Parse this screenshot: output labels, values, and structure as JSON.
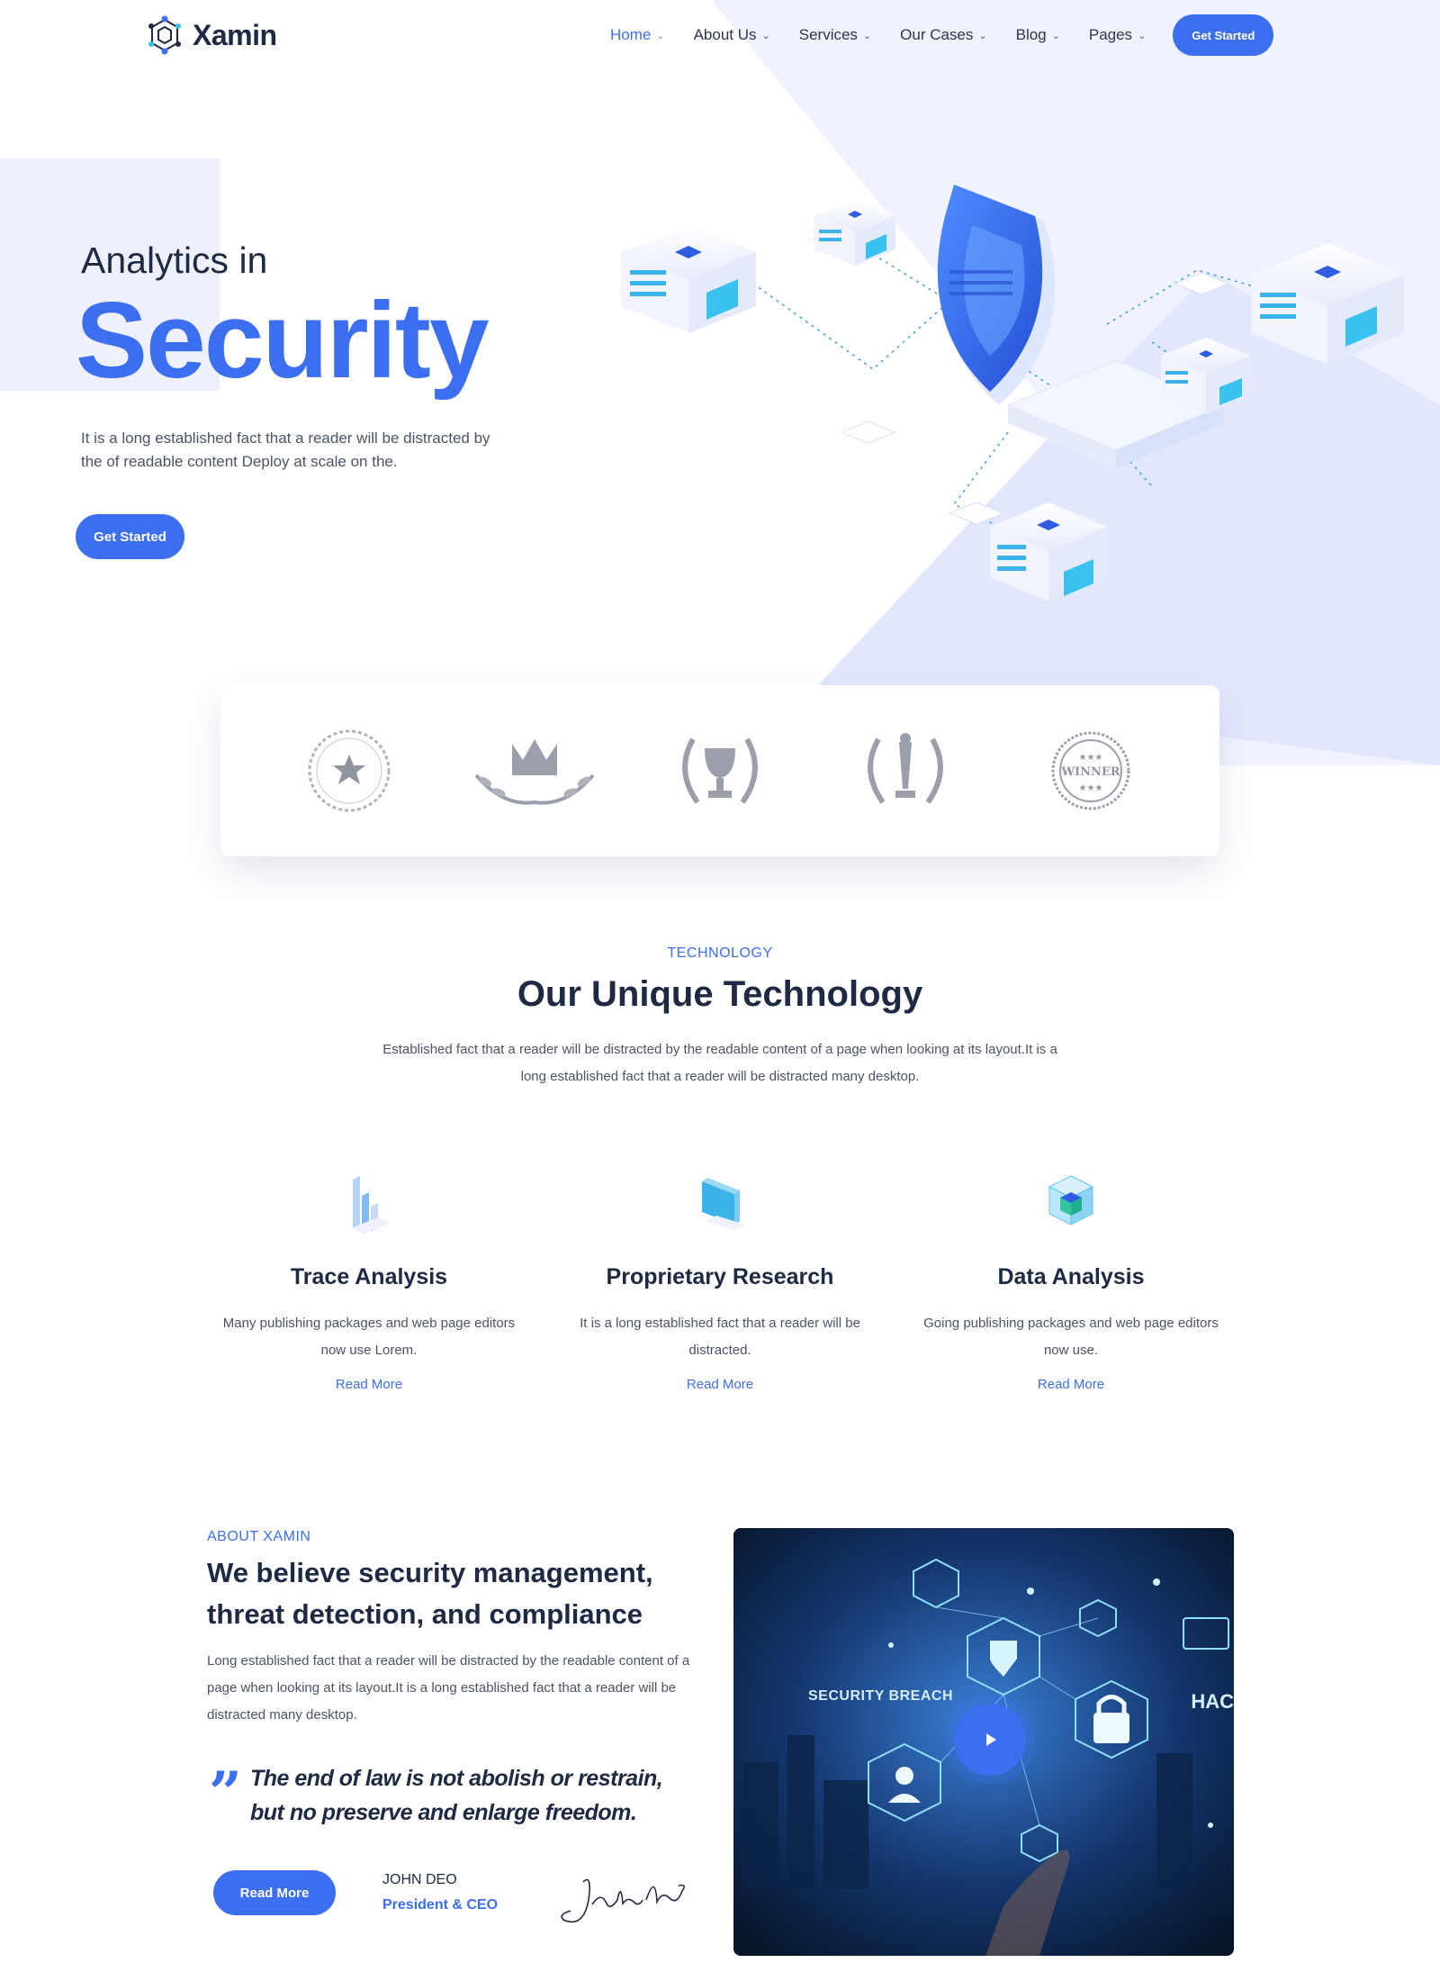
{
  "brand": {
    "name": "Xamin",
    "accent": "#3c6ff0",
    "dark": "#1e2a44"
  },
  "nav": {
    "items": [
      {
        "label": "Home",
        "active": true
      },
      {
        "label": "About Us"
      },
      {
        "label": "Services"
      },
      {
        "label": "Our Cases"
      },
      {
        "label": "Blog"
      },
      {
        "label": "Pages"
      }
    ],
    "cta": "Get Started",
    "chevron_icon": "chevron-down-icon"
  },
  "hero": {
    "subtitle": "Analytics in",
    "title": "Security",
    "description": "It is a long established fact that a reader will be distracted by the of readable content Deploy at scale on the.",
    "button": "Get Started"
  },
  "awards": {
    "items": [
      {
        "icon": "star-badge-icon"
      },
      {
        "icon": "crown-laurel-icon"
      },
      {
        "icon": "trophy-laurel-icon"
      },
      {
        "icon": "award-laurel-icon"
      },
      {
        "icon": "winner-seal-icon",
        "text": "WINNER"
      }
    ]
  },
  "technology": {
    "eyebrow": "TECHNOLOGY",
    "title": "Our Unique Technology",
    "description": "Established fact that a reader will be distracted by the readable content of a page when looking at its layout.It is a long established fact that a reader will be distracted many desktop.",
    "features": [
      {
        "icon": "bar-chart-icon",
        "title": "Trace Analysis",
        "description": "Many publishing packages and web page editors now use Lorem.",
        "link": "Read More"
      },
      {
        "icon": "research-panel-icon",
        "title": "Proprietary Research",
        "description": "It is a long established fact that a reader will be distracted.",
        "link": "Read More"
      },
      {
        "icon": "data-cube-icon",
        "title": "Data Analysis",
        "description": "Going publishing packages and web page editors now use.",
        "link": "Read More"
      }
    ]
  },
  "about": {
    "eyebrow": "ABOUT XAMIN",
    "title": "We believe security management, threat detection, and compliance",
    "description": "Long established fact that a reader will be distracted by the readable content of a page when looking at its layout.It is a long established fact that a reader will be distracted many desktop.",
    "quote": "The end of law is not abolish or restrain, but no preserve and enlarge freedom.",
    "button": "Read More",
    "ceo_name": "JOHN DEO",
    "ceo_role": "President & CEO",
    "signature_text": "john deo",
    "video": {
      "label_breach": "SECURITY BREACH",
      "label_hack": "HAC",
      "play_icon": "play-icon"
    }
  }
}
